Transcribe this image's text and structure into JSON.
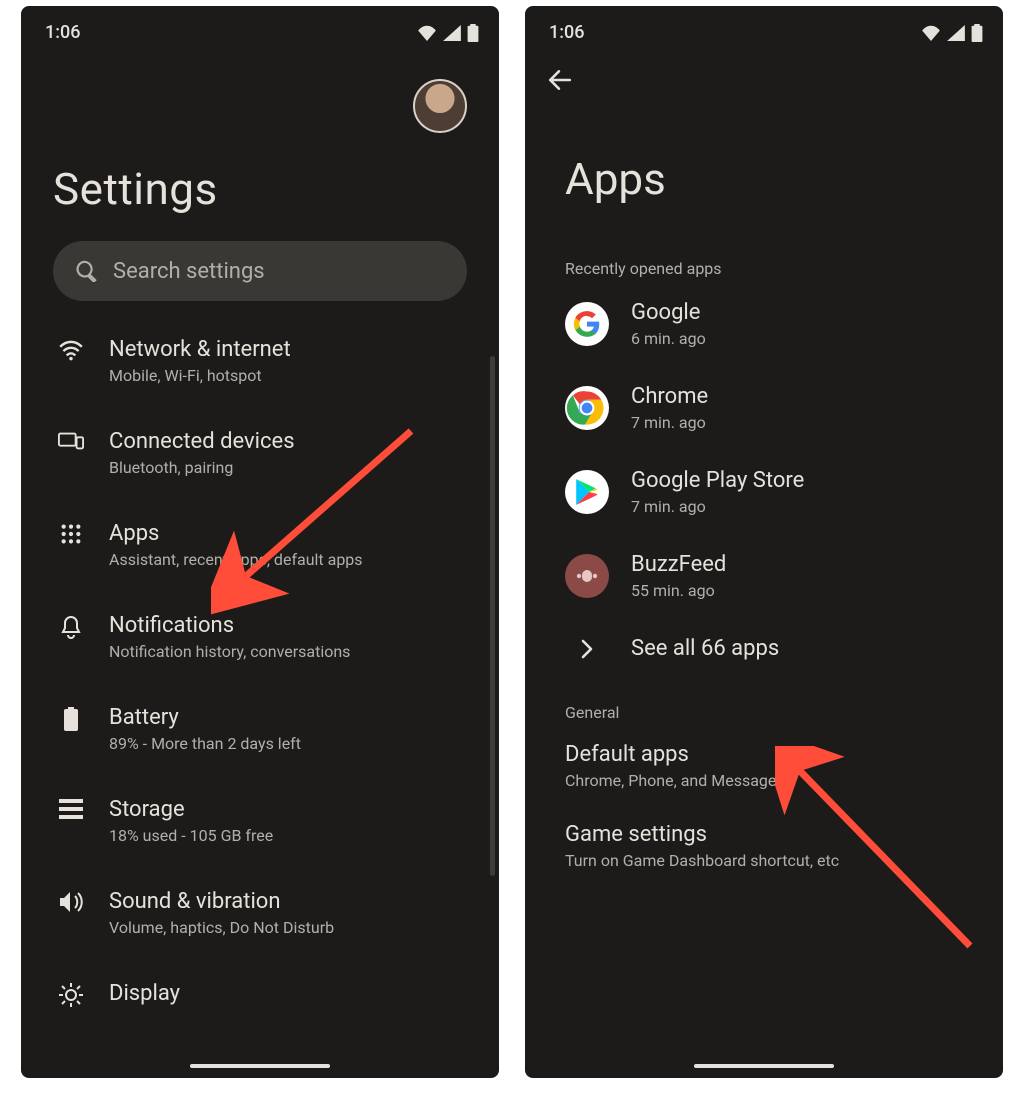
{
  "status": {
    "time": "1:06"
  },
  "screen1": {
    "title": "Settings",
    "search_placeholder": "Search settings",
    "items": [
      {
        "icon": "wifi-icon",
        "title": "Network & internet",
        "subtitle": "Mobile, Wi-Fi, hotspot"
      },
      {
        "icon": "devices-icon",
        "title": "Connected devices",
        "subtitle": "Bluetooth, pairing"
      },
      {
        "icon": "apps-icon",
        "title": "Apps",
        "subtitle": "Assistant, recent apps, default apps"
      },
      {
        "icon": "bell-icon",
        "title": "Notifications",
        "subtitle": "Notification history, conversations"
      },
      {
        "icon": "battery-icon",
        "title": "Battery",
        "subtitle": "89% - More than 2 days left"
      },
      {
        "icon": "storage-icon",
        "title": "Storage",
        "subtitle": "18% used - 105 GB free"
      },
      {
        "icon": "sound-icon",
        "title": "Sound & vibration",
        "subtitle": "Volume, haptics, Do Not Disturb"
      },
      {
        "icon": "display-icon",
        "title": "Display",
        "subtitle": ""
      }
    ]
  },
  "screen2": {
    "title": "Apps",
    "recent_label": "Recently opened apps",
    "recent": [
      {
        "icon": "google-icon",
        "title": "Google",
        "subtitle": "6 min. ago"
      },
      {
        "icon": "chrome-icon",
        "title": "Chrome",
        "subtitle": "7 min. ago"
      },
      {
        "icon": "play-icon",
        "title": "Google Play Store",
        "subtitle": "7 min. ago"
      },
      {
        "icon": "buzzfeed-icon",
        "title": "BuzzFeed",
        "subtitle": "55 min. ago"
      }
    ],
    "see_all": "See all 66 apps",
    "general_label": "General",
    "general": [
      {
        "title": "Default apps",
        "subtitle": "Chrome, Phone, and Messages"
      },
      {
        "title": "Game settings",
        "subtitle": "Turn on Game Dashboard shortcut, etc"
      }
    ]
  }
}
